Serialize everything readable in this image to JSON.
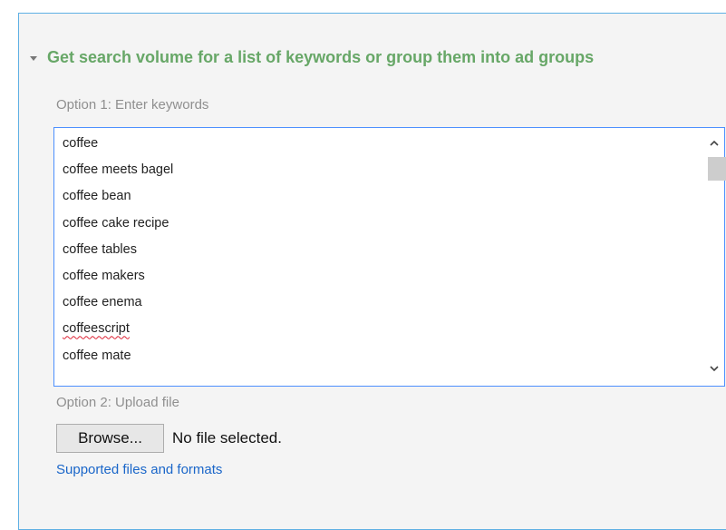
{
  "section": {
    "title": "Get search volume for a list of keywords or group them into ad groups",
    "expanded": true
  },
  "option1": {
    "label": "Option 1: Enter keywords",
    "keywords": [
      "coffee",
      "coffee meets bagel",
      "coffee bean",
      "coffee cake recipe",
      "coffee tables",
      "coffee makers",
      "coffee enema",
      "coffeescript",
      "coffee mate"
    ]
  },
  "option2": {
    "label": "Option 2: Upload file",
    "browse_label": "Browse...",
    "file_status": "No file selected.",
    "supported_link": "Supported files and formats"
  },
  "colors": {
    "title_green": "#67a767",
    "link_blue": "#1a66c9",
    "focus_border": "#4d90fe"
  },
  "icons": {
    "expand": "triangle-down-icon",
    "scroll_up": "chevron-up-icon",
    "scroll_down": "chevron-down-icon"
  }
}
